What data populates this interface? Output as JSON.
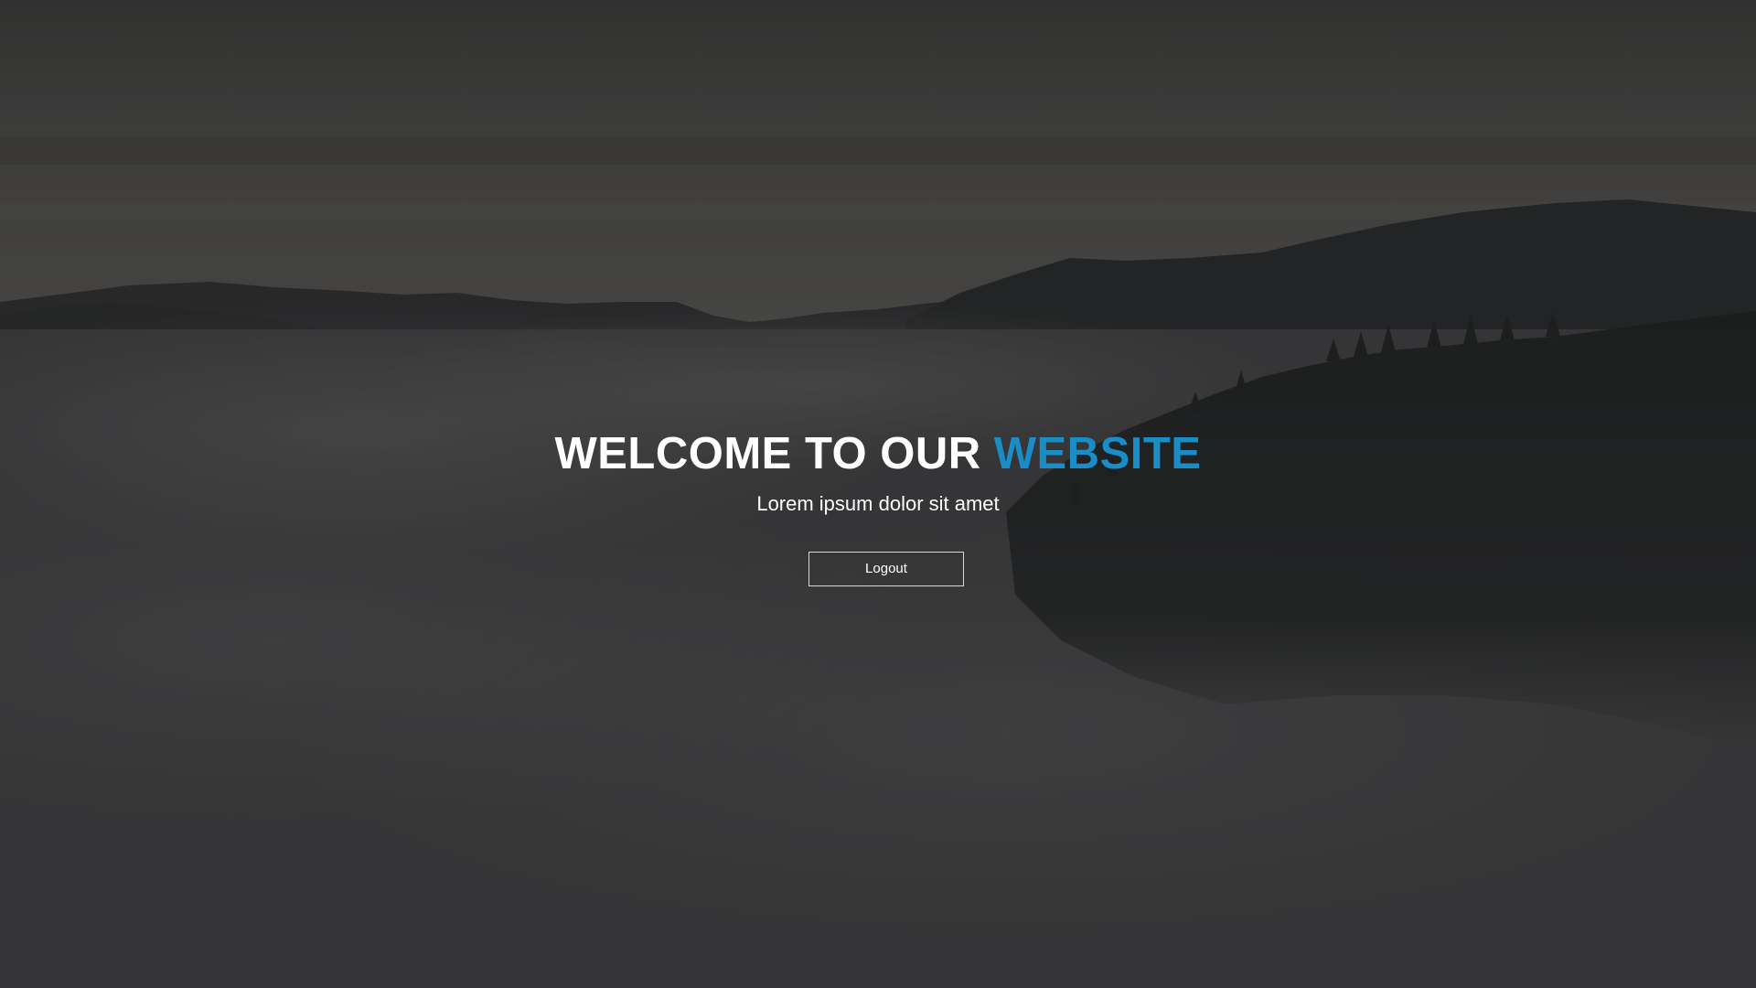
{
  "hero": {
    "title_main": "WELCOME TO OUR ",
    "title_accent": "WEBSITE",
    "subtitle": "Lorem ipsum dolor sit amet",
    "logout_label": "Logout"
  },
  "colors": {
    "accent": "#1a8cc6",
    "text": "#ffffff",
    "button_border": "#d8d8d8"
  },
  "background": {
    "icon": "foggy-mountain-forest-landscape"
  }
}
